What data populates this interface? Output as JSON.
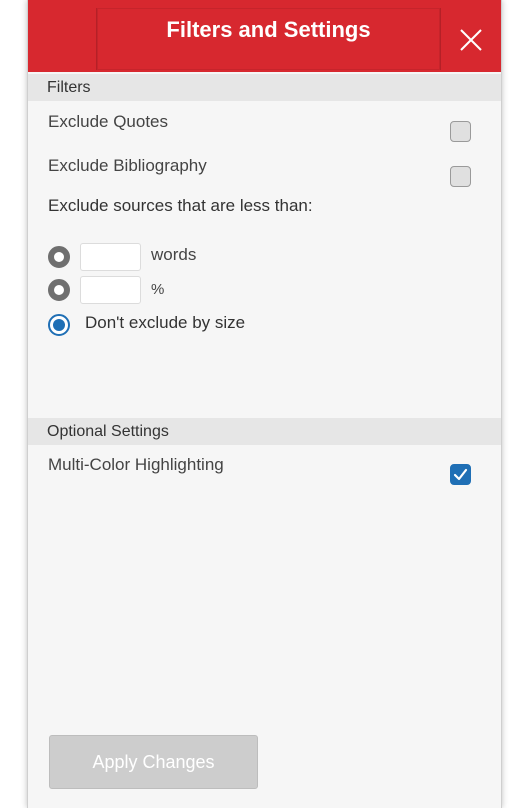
{
  "header": {
    "title": "Filters and Settings",
    "close_icon": "close-icon"
  },
  "filters": {
    "section_label": "Filters",
    "exclude_quotes": {
      "label": "Exclude Quotes",
      "checked": false
    },
    "exclude_bibliography": {
      "label": "Exclude Bibliography",
      "checked": false
    },
    "size_prompt": "Exclude sources that are less than:",
    "size_options": [
      {
        "unit": "words",
        "value": "",
        "selected": false
      },
      {
        "unit": "%",
        "value": "",
        "selected": false
      },
      {
        "label": "Don't exclude by size",
        "selected": true
      }
    ]
  },
  "optional_settings": {
    "section_label": "Optional Settings",
    "multi_color": {
      "label": "Multi-Color Highlighting",
      "checked": true
    }
  },
  "footer": {
    "apply_label": "Apply Changes"
  },
  "colors": {
    "header_red": "#d7282f",
    "accent_blue": "#1f6fb5",
    "panel_bg": "#f6f6f6",
    "section_bg": "#e6e6e6",
    "disabled_button": "#cdcdcd"
  }
}
